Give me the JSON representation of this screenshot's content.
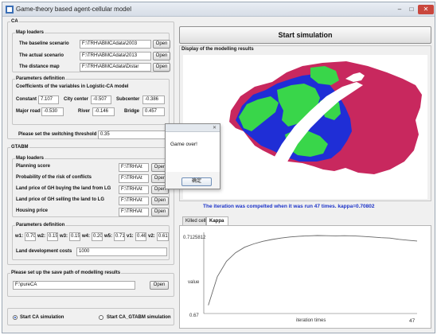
{
  "window": {
    "title": "Game-theory based agent-cellular model",
    "minimize": "–",
    "maximize": "□",
    "close": "✕"
  },
  "ca": {
    "title": "CA",
    "map_loaders": {
      "title": "Map loaders",
      "rows": [
        {
          "label": "The baseline scenario",
          "path": "F:\\TRH\\ABMCAdata\\2003",
          "button": "Open"
        },
        {
          "label": "The actual scenario",
          "path": "F:\\TRH\\ABMCAdata\\2013",
          "button": "Open"
        },
        {
          "label": "The distance map",
          "path": "F:\\TRH\\ABMCAdata\\Distar",
          "button": "Open"
        }
      ]
    },
    "parameters": {
      "title": "Parameters definition",
      "subtitle": "Coefficients of the variables in Logistic-CA model",
      "constant_label": "Constant",
      "constant": "7.107",
      "city_center_label": "City center",
      "city_center": "-0.507",
      "subcenter_label": "Subcenter",
      "subcenter": "-0.386",
      "major_road_label": "Major road",
      "major_road": "-0.530",
      "river_label": "River",
      "river": "-0.146",
      "bridge_label": "Bridge",
      "bridge": "0.457"
    },
    "threshold_label": "Please set the switching threshold",
    "threshold": "0.35"
  },
  "gtabm": {
    "title": "GTABM",
    "map_loaders": {
      "title": "Map loaders",
      "rows": [
        {
          "label": "Planning score",
          "path": "F:\\TRH\\At",
          "button": "Open"
        },
        {
          "label": "Probability of the risk of conflicts",
          "path": "F:\\TRH\\At",
          "button": "Open"
        },
        {
          "label": "Land price of GH buying the land from LG",
          "path": "F:\\TRH\\At",
          "button": "Open"
        },
        {
          "label": "Land price of GH selling the land to LG",
          "path": "F:\\TRH\\At",
          "button": "Open"
        },
        {
          "label": "Housing price",
          "path": "F:\\TRH\\At",
          "button": "Open"
        }
      ]
    },
    "parameters": {
      "title": "Parameters definition",
      "weights": [
        {
          "label": "w1:",
          "value": "0.70"
        },
        {
          "label": "w2:",
          "value": "0.15"
        },
        {
          "label": "w3:",
          "value": "0.15"
        },
        {
          "label": "w4:",
          "value": "0.20"
        },
        {
          "label": "w5:",
          "value": "0.71"
        },
        {
          "label": "v1:",
          "value": "0.46"
        },
        {
          "label": "v2:",
          "value": "0.61"
        }
      ],
      "costs_label": "Land development costs",
      "costs": "1000"
    }
  },
  "save": {
    "title": "Please set up the save path of modelling results",
    "path": "F:\\pureCA",
    "button": "Open"
  },
  "modes": {
    "option1": "Start CA simulation",
    "option2": "Start CA_GTABM simulation",
    "selected": "option1"
  },
  "start_button": "Start simulation",
  "display": {
    "title": "Display of the modelling results",
    "colors": {
      "background": "#ffffff",
      "magenta": "#c8285e",
      "blue": "#1f2ed6",
      "green": "#39d64a",
      "river": "#ffffff"
    }
  },
  "status_message": "The iteration was compelted when it was run 47 times.  kappa=0.70802",
  "tabs": [
    {
      "label": "Killed cells"
    },
    {
      "label": "Kappa"
    }
  ],
  "active_tab": "Kappa",
  "chart_data": {
    "type": "line",
    "title": "",
    "xlabel": "iteration times",
    "ylabel": "value",
    "x_max_label": "47",
    "y_max_label": "0.7125812",
    "y_min_label": "0.67",
    "xlim": [
      0,
      47
    ],
    "ylim": [
      0.67,
      0.7125812
    ],
    "series": [
      {
        "x": [
          1,
          3,
          5,
          7,
          9,
          11,
          13,
          15,
          17,
          19,
          21,
          23,
          25,
          27,
          29,
          31,
          33,
          35,
          37,
          39,
          41,
          43,
          45,
          47
        ],
        "values": [
          0.6745,
          0.6902,
          0.6985,
          0.7032,
          0.7062,
          0.708,
          0.7094,
          0.7104,
          0.7112,
          0.7118,
          0.7122,
          0.7124,
          0.7126,
          0.7125,
          0.7124,
          0.7125,
          0.7124,
          0.7121,
          0.7118,
          0.7114,
          0.7112,
          0.7105,
          0.71,
          0.7096
        ]
      }
    ]
  },
  "dialog": {
    "message": "Game over!",
    "ok_button": "确定",
    "close": "✕"
  }
}
